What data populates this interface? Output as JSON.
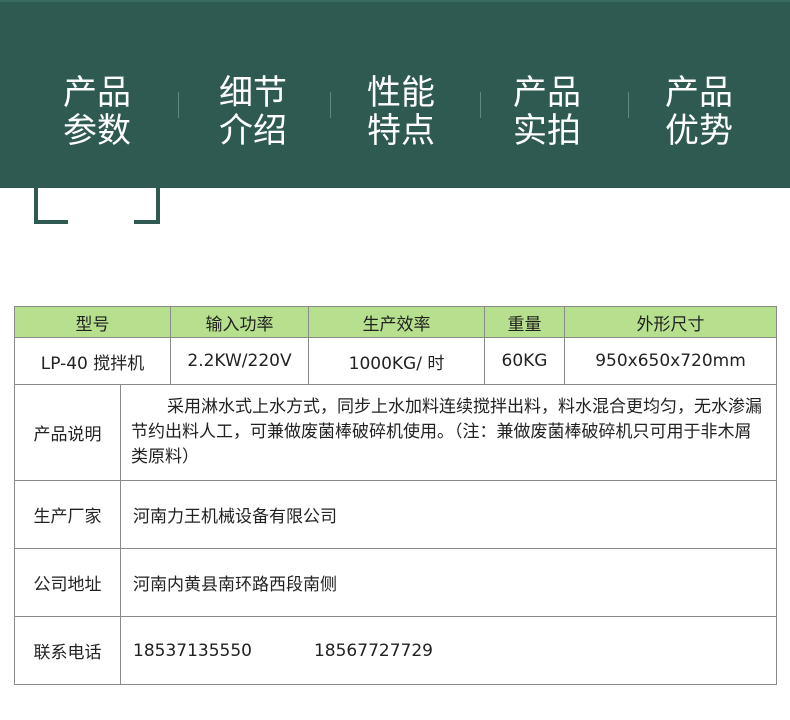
{
  "nav": {
    "items": [
      {
        "line1": "产品",
        "line2": "参数"
      },
      {
        "line1": "细节",
        "line2": "介绍"
      },
      {
        "line1": "性能",
        "line2": "特点"
      },
      {
        "line1": "产品",
        "line2": "实拍"
      },
      {
        "line1": "产品",
        "line2": "优势"
      }
    ],
    "active_index": 0
  },
  "colors": {
    "banner": "#2e5a52",
    "header_row": "#b7e08e",
    "border": "#8a8a8a"
  },
  "table": {
    "headers": [
      "型号",
      "输入功率",
      "生产效率",
      "重量",
      "外形尺寸"
    ],
    "row": [
      "LP-40 搅拌机",
      "2.2KW/220V",
      "1000KG/ 时",
      "60KG",
      "950x650x720mm"
    ],
    "description_label": "产品说明",
    "description": "采用淋水式上水方式，同步上水加料连续搅拌出料，料水混合更均匀，无水渗漏节约出料人工，可兼做废菌棒破碎机使用。（注：兼做废菌棒破碎机只可用于非木屑类原料）",
    "manufacturer_label": "生产厂家",
    "manufacturer": "河南力王机械设备有限公司",
    "address_label": "公司地址",
    "address": "河南内黄县南环路西段南侧",
    "phone_label": "联系电话",
    "phone1": "18537135550",
    "phone2": "18567727729"
  }
}
